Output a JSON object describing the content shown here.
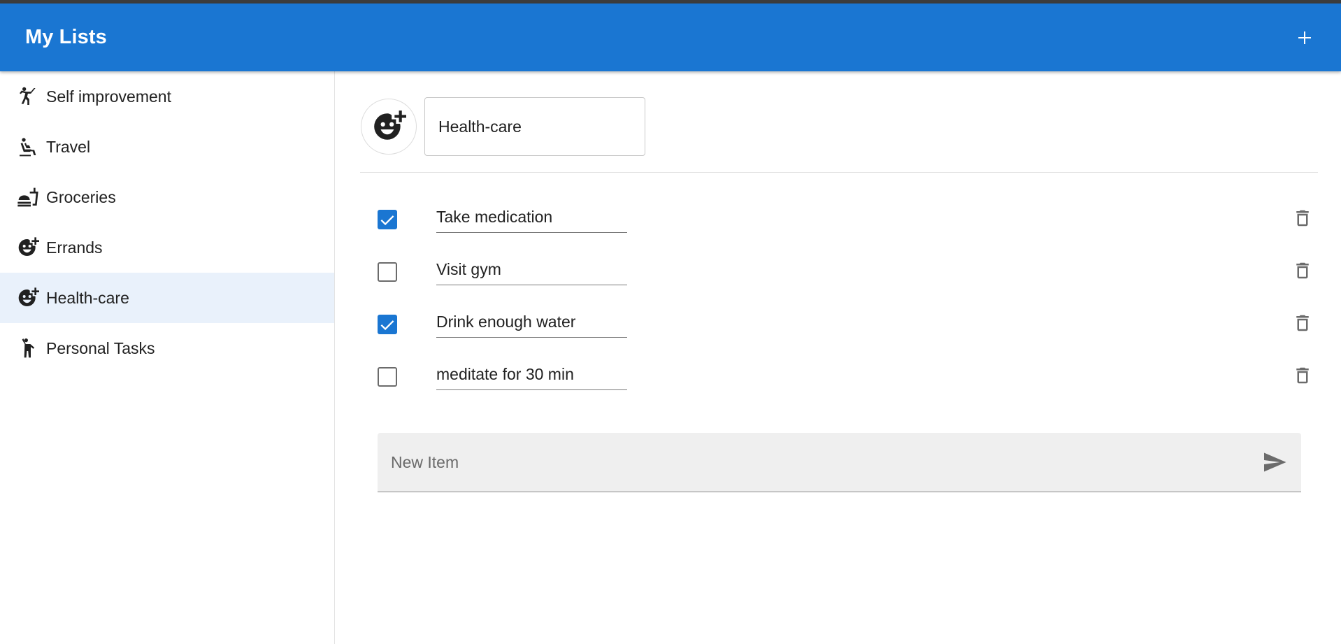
{
  "app": {
    "title": "My Lists",
    "add_icon": "plus-icon",
    "accent": "#1a76d2"
  },
  "sidebar": {
    "items": [
      {
        "label": "Self improvement",
        "icon": "sports-martial-arts-icon",
        "active": false
      },
      {
        "label": "Travel",
        "icon": "airline-seat-icon",
        "active": false
      },
      {
        "label": "Groceries",
        "icon": "fastfood-icon",
        "active": false
      },
      {
        "label": "Errands",
        "icon": "add-reaction-icon",
        "active": false
      },
      {
        "label": "Health-care",
        "icon": "add-reaction-icon",
        "active": true
      },
      {
        "label": "Personal Tasks",
        "icon": "person-walking-icon",
        "active": false
      }
    ]
  },
  "list": {
    "icon": "add-reaction-icon",
    "name": "Health-care",
    "items": [
      {
        "text": "Take medication",
        "checked": true
      },
      {
        "text": "Visit gym",
        "checked": false
      },
      {
        "text": "Drink enough water",
        "checked": true
      },
      {
        "text": "meditate for 30 min",
        "checked": false
      }
    ],
    "new_item_placeholder": "New Item",
    "send_icon": "send-icon",
    "delete_icon": "trash-icon"
  }
}
